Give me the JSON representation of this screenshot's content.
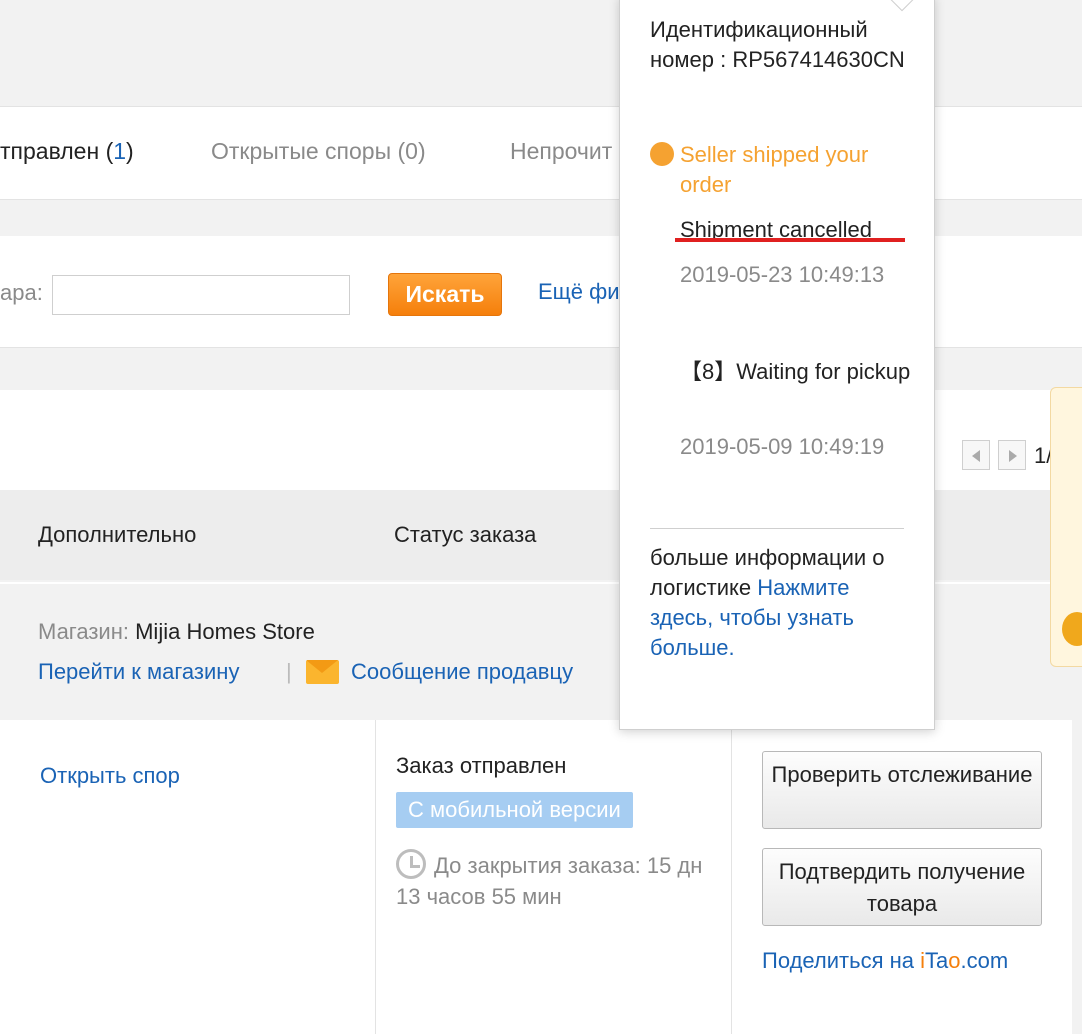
{
  "tabs": {
    "shipped_label": "тправлен (",
    "shipped_count": "1",
    "shipped_close": ")",
    "disputes": "Открытые споры (0)",
    "unread": "Непрочит"
  },
  "search": {
    "label": "ара:",
    "value": "",
    "button": "Искать",
    "more_filters": "Ещё фи"
  },
  "pager": {
    "text": "1/"
  },
  "table_headers": {
    "additional": "Дополнительно",
    "order_status": "Статус заказа"
  },
  "store": {
    "label": "Магазин:",
    "name": "Mijia Homes Store",
    "go_to_store": "Перейти к магазину",
    "separator": "|",
    "message_seller": "Сообщение продавцу"
  },
  "order": {
    "open_dispute": "Открыть спор",
    "status": "Заказ отправлен",
    "mobile_badge": "С мобильной версии",
    "countdown": "До закрытия заказа: 15 дн 13 часов 55 мин",
    "track_button": "Проверить отслеживание",
    "confirm_button": "Подтвердить получение товара",
    "share_prefix": "Поделиться на ",
    "share_i": "i",
    "share_ta": "Ta",
    "share_o": "o",
    "share_suffix": ".com"
  },
  "popup": {
    "tracking_id": "Идентификационный номер : RP567414630CN",
    "shipped_status": "Seller shipped your order",
    "events": [
      {
        "title": "Shipment cancelled",
        "date": "2019-05-23 10:49:13"
      },
      {
        "title": "【8】Waiting for pickup",
        "date": "2019-05-09 10:49:19"
      }
    ],
    "more_info": "больше информации о логистике ",
    "more_link": "Нажмите здесь, чтобы узнать больше."
  },
  "colors": {
    "link_blue": "#1a63b5",
    "accent_orange": "#f57f0b",
    "status_orange": "#f5a231",
    "highlight_red": "#e02020",
    "badge_blue": "#a6cdf2"
  },
  "icons": [
    "mail-icon",
    "clock-icon",
    "status-dot-icon",
    "chevron-left-icon",
    "chevron-right-icon",
    "mascot-icon"
  ]
}
